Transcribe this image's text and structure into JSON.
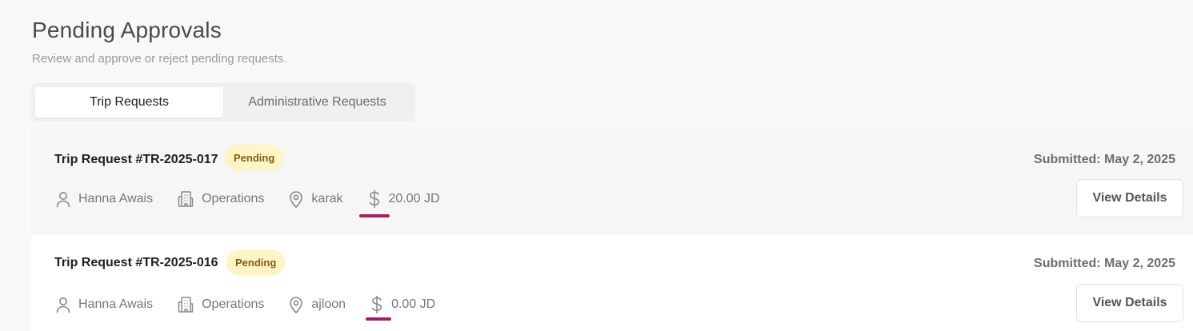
{
  "header": {
    "title": "Pending Approvals",
    "subtitle": "Review and approve or reject pending requests."
  },
  "tabs": [
    {
      "label": "Trip Requests",
      "active": true
    },
    {
      "label": "Administrative Requests",
      "active": false
    }
  ],
  "requests": [
    {
      "title": "Trip Request #TR-2025-017",
      "status": "Pending",
      "submitted": "Submitted: May 2, 2025",
      "requester": "Hanna Awais",
      "department": "Operations",
      "location": "karak",
      "amount": "20.00 JD",
      "action_label": "View Details"
    },
    {
      "title": "Trip Request #TR-2025-016",
      "status": "Pending",
      "submitted": "Submitted: May 2, 2025",
      "requester": "Hanna Awais",
      "department": "Operations",
      "location": "ajloon",
      "amount": "0.00 JD",
      "action_label": "View Details"
    }
  ],
  "icons": {
    "requester": "user-icon",
    "department": "building-icon",
    "location": "map-pin-icon",
    "amount": "dollar-icon"
  },
  "colors": {
    "badge_bg": "#fdf5c4",
    "badge_text": "#8a5a12",
    "highlight_underline": "#b0195f"
  }
}
